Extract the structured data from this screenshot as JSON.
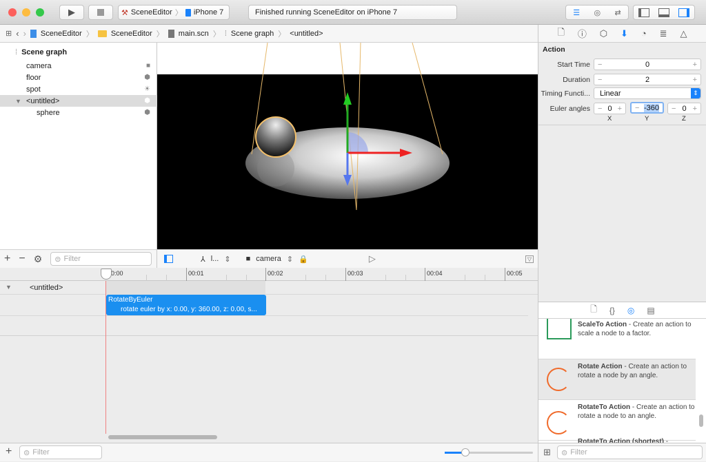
{
  "toolbar": {
    "scheme": "SceneEditor",
    "device": "iPhone 7",
    "status": "Finished running SceneEditor on iPhone 7"
  },
  "jumpbar": {
    "items": [
      "SceneEditor",
      "SceneEditor",
      "main.scn",
      "Scene graph",
      "<untitled>"
    ]
  },
  "outline": {
    "title": "Scene graph",
    "items": [
      {
        "label": "camera",
        "icon": "camera-icon"
      },
      {
        "label": "floor",
        "icon": "cube-icon"
      },
      {
        "label": "spot",
        "icon": "sun-icon"
      },
      {
        "label": "<untitled>",
        "icon": "cube-icon",
        "selected": true
      },
      {
        "label": "sphere",
        "icon": "cube-icon"
      }
    ],
    "filter_placeholder": "Filter"
  },
  "viewport_bar": {
    "pov_label": "l...",
    "camera_label": "camera"
  },
  "timeline": {
    "ticks": [
      "00:00",
      "00:01",
      "00:02",
      "00:03",
      "00:04",
      "00:05"
    ],
    "track_label": "<untitled>",
    "action": {
      "title": "RotateByEuler",
      "detail": "rotate euler by x: 0.00, y: 360.00, z: 0.00, s..."
    },
    "filter_placeholder": "Filter"
  },
  "inspector": {
    "section": "Action",
    "start_time_label": "Start Time",
    "start_time": "0",
    "duration_label": "Duration",
    "duration": "2",
    "timing_label": "Timing Functi...",
    "timing": "Linear",
    "euler_label": "Euler angles",
    "euler_x": "0",
    "euler_y": "-360",
    "euler_z": "0",
    "axis_x": "X",
    "axis_y": "Y",
    "axis_z": "Z",
    "accent": "#1a82fb"
  },
  "library": {
    "items": [
      {
        "name": "ScaleTo Action",
        "desc": " - Create an action to scale a node to a factor."
      },
      {
        "name": "Rotate Action",
        "desc": " - Create an action to rotate a node by an angle.",
        "selected": true
      },
      {
        "name": "RotateTo Action",
        "desc": " - Create an action to rotate a node to an angle."
      },
      {
        "name": "RotateTo Action (shortest)",
        "desc": " -"
      }
    ],
    "filter_placeholder": "Filter"
  }
}
